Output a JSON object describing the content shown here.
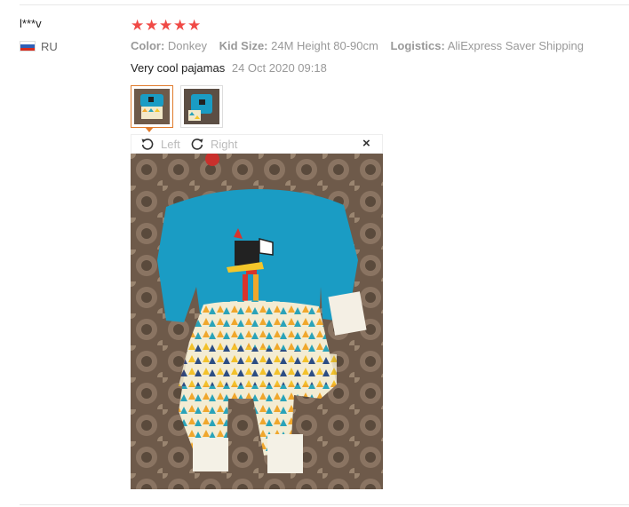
{
  "reviewer": {
    "name": "l***v",
    "country": "RU",
    "flag_icon": "russia-flag-icon"
  },
  "rating": {
    "stars": 5,
    "max": 5,
    "star_char": "★",
    "color": "#f04a46"
  },
  "attributes": [
    {
      "key": "Color:",
      "value": "Donkey"
    },
    {
      "key": "Kid Size:",
      "value": "24M Height 80-90cm"
    },
    {
      "key": "Logistics:",
      "value": "AliExpress Saver Shipping"
    }
  ],
  "review": {
    "text": "Very cool pajamas",
    "date": "24 Oct 2020 09:18"
  },
  "toolbar": {
    "left_label": "Left",
    "right_label": "Right",
    "close_label": "×"
  },
  "thumbnails": [
    {
      "selected": true
    },
    {
      "selected": false
    }
  ],
  "colors": {
    "accent": "#e07b2c",
    "shirt": "#1a9cc4",
    "carpet": "#6e5a4a"
  }
}
